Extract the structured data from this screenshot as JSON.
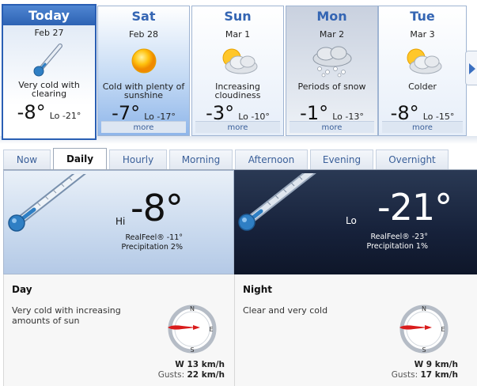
{
  "days": [
    {
      "name": "Today",
      "date": "Feb 27",
      "icon": "thermometer-cold-icon",
      "desc": "Very cold with clearing",
      "hi": "-8°",
      "lo": "Lo -21°",
      "more": ""
    },
    {
      "name": "Sat",
      "date": "Feb 28",
      "icon": "sun-icon",
      "desc": "Cold with plenty of sunshine",
      "hi": "-7°",
      "lo": "Lo -17°",
      "more": "more"
    },
    {
      "name": "Sun",
      "date": "Mar 1",
      "icon": "partly-cloudy-icon",
      "desc": "Increasing cloudiness",
      "hi": "-3°",
      "lo": "Lo -10°",
      "more": "more"
    },
    {
      "name": "Mon",
      "date": "Mar 2",
      "icon": "snow-cloud-icon",
      "desc": "Periods of snow",
      "hi": "-1°",
      "lo": "Lo -13°",
      "more": "more"
    },
    {
      "name": "Tue",
      "date": "Mar 3",
      "icon": "partly-cloudy-icon",
      "desc": "Colder",
      "hi": "-8°",
      "lo": "Lo -15°",
      "more": "more"
    }
  ],
  "tabs": [
    "Now",
    "Daily",
    "Hourly",
    "Morning",
    "Afternoon",
    "Evening",
    "Overnight"
  ],
  "active_tab": "Daily",
  "hero_day": {
    "label": "Hi",
    "temp": "-8°",
    "realfeel": "RealFeel® -11°",
    "precip": "Precipitation 2%"
  },
  "hero_night": {
    "label": "Lo",
    "temp": "-21°",
    "realfeel": "RealFeel® -23°",
    "precip": "Precipitation 1%"
  },
  "detail_day": {
    "title": "Day",
    "desc": "Very cold with increasing amounts of sun",
    "compass": {
      "n": "N",
      "e": "E",
      "s": "S"
    },
    "wind": "W 13 km/h",
    "gusts_label": "Gusts:",
    "gusts": "22 km/h"
  },
  "detail_night": {
    "title": "Night",
    "desc": "Clear and very cold",
    "compass": {
      "n": "N",
      "e": "E",
      "s": "S"
    },
    "wind": "W 9 km/h",
    "gusts_label": "Gusts:",
    "gusts": "17 km/h"
  },
  "colors": {
    "accent": "#2a5fb4",
    "wind_arrow": "#d91c1c",
    "night_bg": "#16213a"
  }
}
